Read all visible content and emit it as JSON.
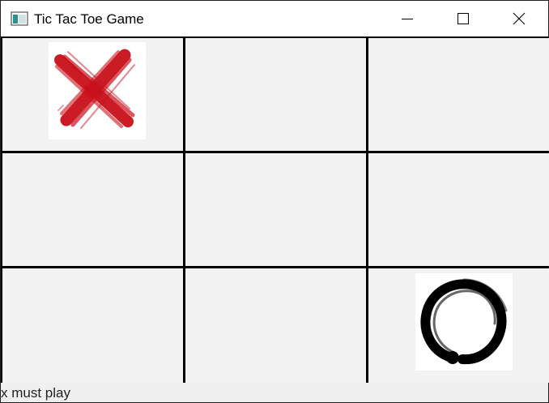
{
  "window": {
    "title": "Tic Tac Toe Game",
    "app_icon": "window-app-icon",
    "controls": {
      "minimize_icon": "minimize-icon",
      "maximize_icon": "maximize-icon",
      "close_icon": "close-icon"
    }
  },
  "board": {
    "rows": 3,
    "columns": 3,
    "cells": [
      [
        "X",
        "",
        ""
      ],
      [
        "",
        "",
        ""
      ],
      [
        "",
        "",
        "O"
      ]
    ],
    "colors": {
      "x_mark": "#c8101a",
      "o_mark": "#000000",
      "cell_background": "#f2f2f2",
      "grid_lines": "#000000"
    }
  },
  "status": {
    "text": "x must play"
  }
}
